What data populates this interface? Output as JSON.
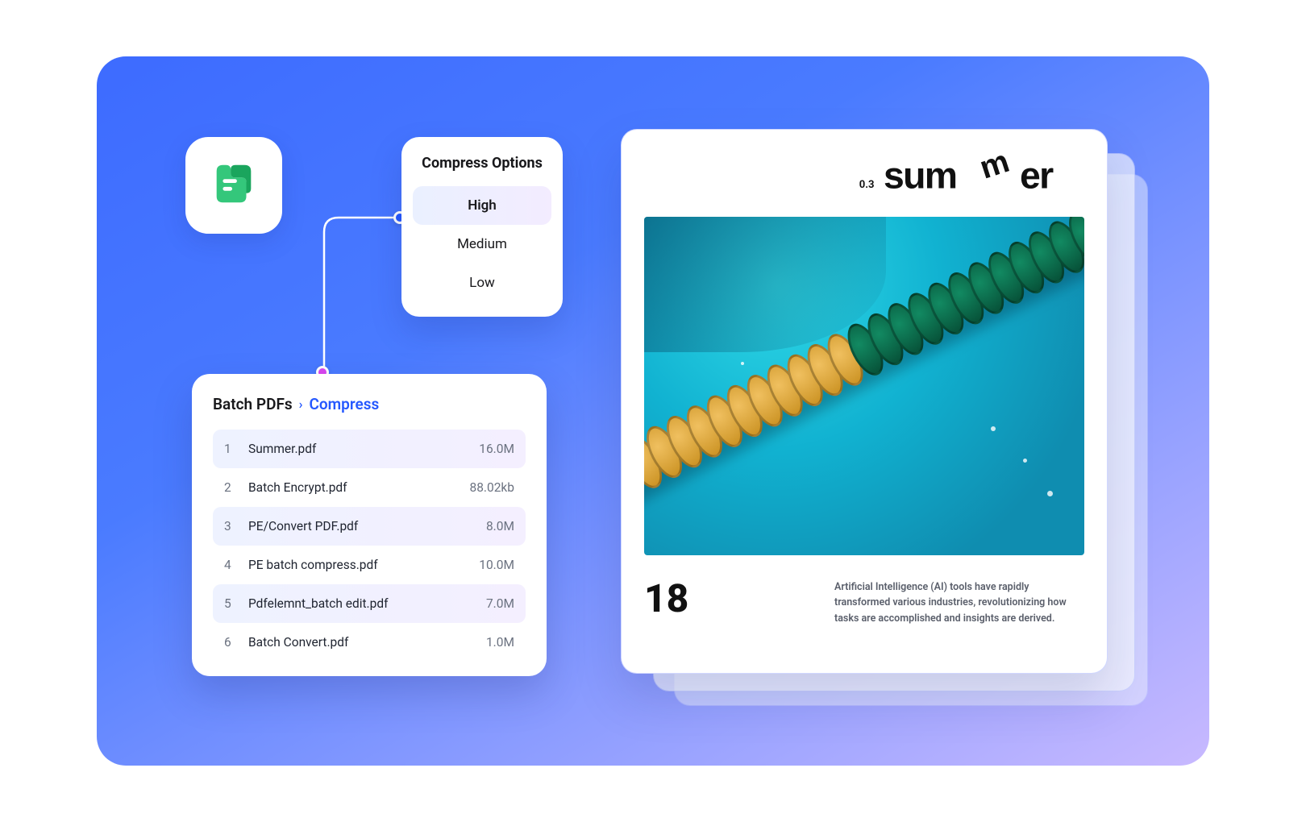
{
  "compress_options": {
    "title": "Compress Options",
    "items": [
      "High",
      "Medium",
      "Low"
    ],
    "selected_index": 0
  },
  "batch": {
    "breadcrumb_root": "Batch PDFs",
    "breadcrumb_current": "Compress",
    "files": [
      {
        "idx": "1",
        "name": "Summer.pdf",
        "size": "16.0M"
      },
      {
        "idx": "2",
        "name": "Batch Encrypt.pdf",
        "size": "88.02kb"
      },
      {
        "idx": "3",
        "name": "PE/Convert PDF.pdf",
        "size": "8.0M"
      },
      {
        "idx": "4",
        "name": "PE batch compress.pdf",
        "size": "10.0M"
      },
      {
        "idx": "5",
        "name": "Pdfelemnt_batch edit.pdf",
        "size": "7.0M"
      },
      {
        "idx": "6",
        "name": "Batch Convert.pdf",
        "size": "1.0M"
      }
    ]
  },
  "document": {
    "subtitle": "0.3",
    "title_word": "summer",
    "page_number": "18",
    "blurb": "Artificial Intelligence (AI) tools have rapidly transformed various industries, revolutionizing how tasks are accomplished and insights are derived."
  }
}
